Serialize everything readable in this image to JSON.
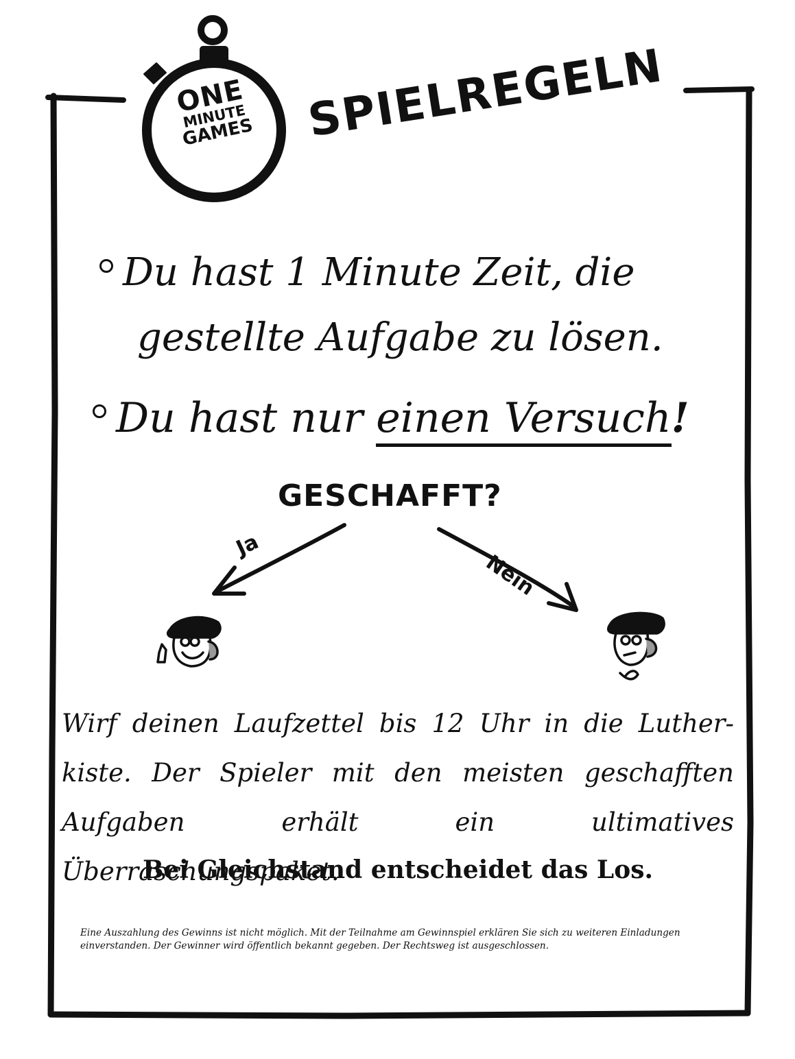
{
  "logo": {
    "line1": "ONE",
    "line2": "MINUTE",
    "line3": "GAMES"
  },
  "title": "SPIELREGELN",
  "rules": {
    "rule1_line1": "Du hast 1 Minute Zeit, die",
    "rule1_line2": "gestellte Aufgabe zu lösen.",
    "rule2_prefix": "Du hast nur ",
    "rule2_emphasis": "einen Versuch",
    "rule2_suffix": "!"
  },
  "question": "GESCHAFFT?",
  "branches": {
    "yes": "Ja",
    "no": "Nein"
  },
  "prize": {
    "line1": "Wirf deinen Laufzettel bis 12 Uhr in die Luther-",
    "line2": "kiste. Der Spieler mit den meisten geschafften",
    "line3": "Aufgaben erhält ein ultimatives Überraschungspaket."
  },
  "tiebreak": "Bei Gleichstand entscheidet das Los.",
  "disclaimer": "Eine Auszahlung des Gewinns ist nicht möglich. Mit der Teilnahme am Gewinnspiel erklären Sie sich zu weiteren Einladungen einverstanden. Der Gewinner wird öffentlich bekannt gegeben. Der Rechtsweg ist ausgeschlossen."
}
